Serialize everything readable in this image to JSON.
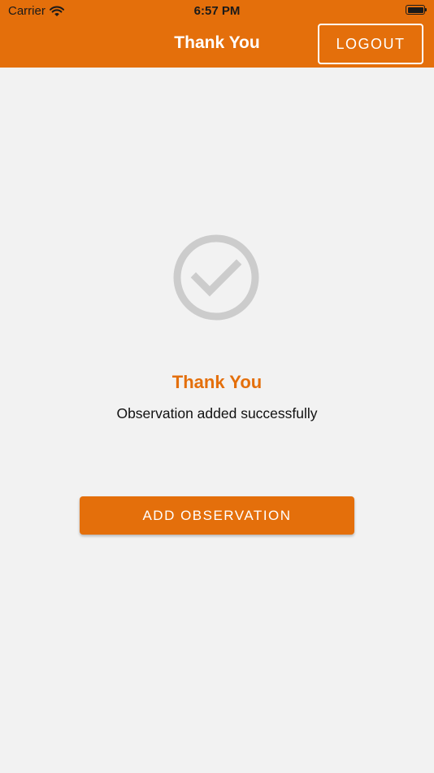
{
  "status_bar": {
    "carrier": "Carrier",
    "time": "6:57 PM",
    "icons": [
      "wifi-icon",
      "battery-icon"
    ]
  },
  "header": {
    "title": "Thank You",
    "logout_label": "LOGOUT"
  },
  "content": {
    "icon": "check-circle-icon",
    "heading": "Thank You",
    "message": "Observation added successfully",
    "button_label": "ADD OBSERVATION"
  },
  "colors": {
    "accent": "#e46f0b",
    "background": "#f2f2f2",
    "icon_gray": "#cccccc"
  }
}
